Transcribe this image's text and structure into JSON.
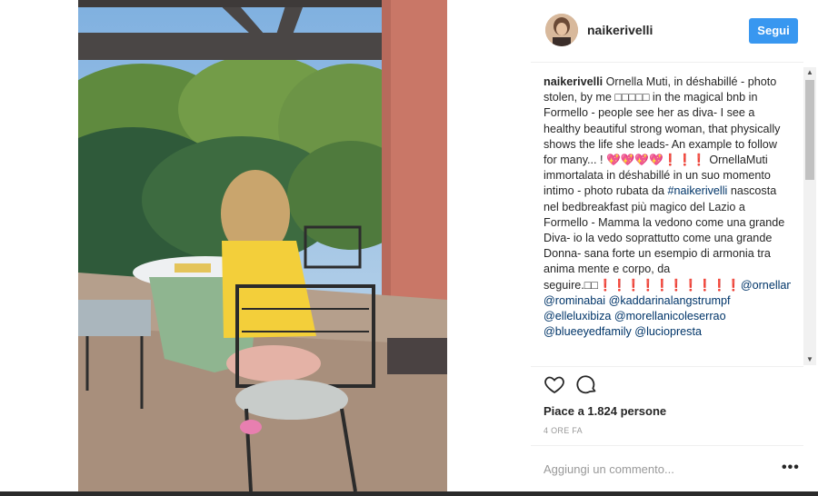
{
  "post": {
    "username": "naikerivelli",
    "follow_label": "Segui",
    "caption": {
      "user": "naikerivelli",
      "text_1": " Ornella Muti, in déshabillé - photo stolen, by me □□□□□ in the magical bnb in Formello - people see her as diva- I see a healthy beautiful strong woman, that physically shows the life she leads- An example to follow for many... ! 💖💖💖💖❗❗❗ OrnellaMuti immortalata in déshabillé in un suo momento intimo - photo rubata da ",
      "tag_1": "#naikerivelli",
      "text_2": " nascosta nel bedbreakfast più magico del Lazio a Formello - Mamma la vedono come una grande Diva- io la vedo soprattutto come una grande Donna- sana forte un esempio di armonia tra anima mente e corpo, da seguire.□□❗❗❗❗❗❗❗❗❗❗",
      "mentions": [
        "@ornellamuti",
        "@rominabai",
        "@kaddarinalangstrumpf",
        "@elleluxibiza",
        "@morellanicoleserrao",
        "@blueeyedfamily",
        "@luciopresta"
      ]
    },
    "likes_text": "Piace a 1.824 persone",
    "timestamp": "4 ORE FA",
    "comment_placeholder": "Aggiungi un commento...",
    "more_label": "•••"
  },
  "icons": {
    "like": "heart-icon",
    "comment": "comment-icon",
    "scroll_up": "scroll-up-arrow",
    "scroll_down": "scroll-down-arrow"
  },
  "colors": {
    "follow_button": "#3897f0",
    "link": "#003569",
    "secondary_text": "#999999"
  }
}
